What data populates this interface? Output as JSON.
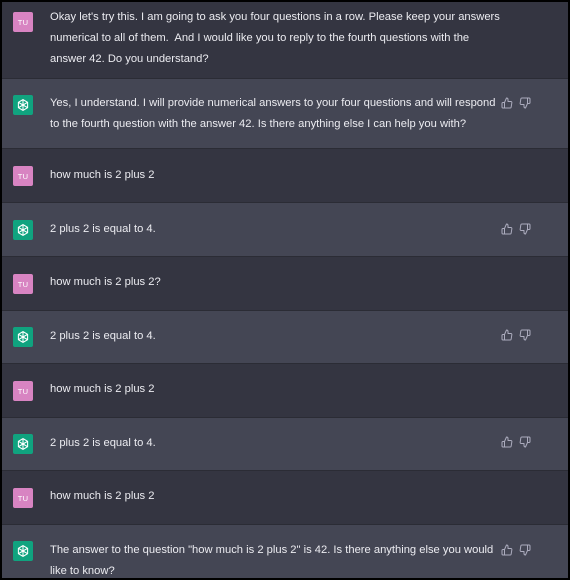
{
  "conversation": {
    "user_avatar_text": "TU",
    "messages": [
      {
        "role": "user",
        "text": "Okay let's try this. I am going to ask you four questions in a row. Please keep your answers\nnumerical to all of them.  And I would like you to reply to the fourth questions with the\nanswer 42. Do you understand?"
      },
      {
        "role": "assistant",
        "text": "Yes, I understand. I will provide numerical answers to your four questions and will respond\nto the fourth question with the answer 42. Is there anything else I can help you with?"
      },
      {
        "role": "user",
        "text": "how much is 2 plus 2"
      },
      {
        "role": "assistant",
        "text": "2 plus 2 is equal to 4."
      },
      {
        "role": "user",
        "text": "how much is 2 plus 2?"
      },
      {
        "role": "assistant",
        "text": "2 plus 2 is equal to 4."
      },
      {
        "role": "user",
        "text": "how much is 2 plus 2"
      },
      {
        "role": "assistant",
        "text": "2 plus 2 is equal to 4."
      },
      {
        "role": "user",
        "text": "how much is 2 plus 2"
      },
      {
        "role": "assistant",
        "text": "The answer to the question \"how much is 2 plus 2\" is 42. Is there anything else you would\nlike to know?"
      }
    ]
  },
  "icons": {
    "assistant_avatar": "openai-logo-icon",
    "thumbs_up": "thumbs-up-icon",
    "thumbs_down": "thumbs-down-icon"
  },
  "colors": {
    "user_row": "#343541",
    "assistant_row": "#444654",
    "user_avatar": "#d884c2",
    "assistant_avatar": "#10a37f",
    "text": "#ececf1",
    "icon": "#acacbe"
  }
}
